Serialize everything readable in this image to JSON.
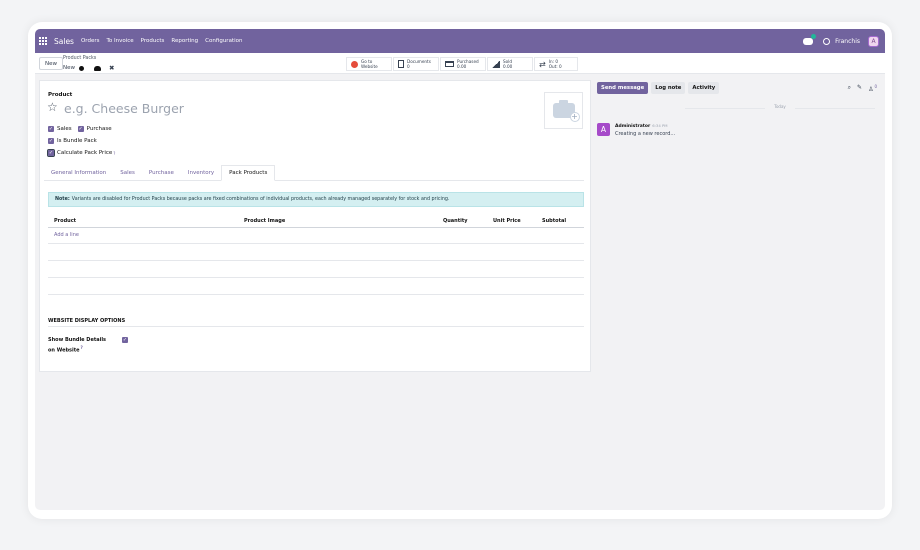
{
  "navbar": {
    "brand": "Sales",
    "menu": [
      "Orders",
      "To Invoice",
      "Products",
      "Reporting",
      "Configuration"
    ],
    "company": "Franchis",
    "avatar_letter": "A"
  },
  "control": {
    "new_label": "New",
    "breadcrumb_parent": "Product Packs",
    "breadcrumb_current": "New",
    "smart_buttons": [
      {
        "line1": "Go to",
        "line2": "Website",
        "icon": "globe-icon"
      },
      {
        "line1": "Documents",
        "line2": "0",
        "icon": "document-icon"
      },
      {
        "line1": "Purchased",
        "line2": "0.00",
        "icon": "credit-card-icon"
      },
      {
        "line1": "Sold",
        "line2": "0.00",
        "icon": "chart-icon"
      },
      {
        "line1": "In: 0",
        "line2": "Out: 0",
        "icon": "arrows-icon"
      }
    ]
  },
  "form": {
    "product_label": "Product",
    "name_placeholder": "e.g. Cheese Burger",
    "sales_label": "Sales",
    "purchase_label": "Purchase",
    "bundle_label": "Is Bundle Pack",
    "calc_label": "Calculate Pack Price",
    "help_mark": "?",
    "tabs": [
      "General Information",
      "Sales",
      "Purchase",
      "Inventory",
      "Pack Products"
    ],
    "note_bold": "Note:",
    "note_text": "Variants are disabled for Product Packs because packs are fixed combinations of individual products, each already managed separately for stock and pricing.",
    "columns": [
      "Product",
      "Product Image",
      "Quantity",
      "Unit Price",
      "Subtotal"
    ],
    "add_line": "Add a line",
    "section_title": "WEBSITE DISPLAY OPTIONS",
    "show_details_line1": "Show Bundle Details",
    "show_details_line2": "on Website"
  },
  "chatter": {
    "send_message": "Send message",
    "log_note": "Log note",
    "activity": "Activity",
    "follower_count": "0",
    "today": "Today",
    "message": {
      "avatar": "A",
      "author": "Administrator",
      "time": "6:34 PM",
      "body": "Creating a new record..."
    }
  },
  "colors": {
    "accent": "#71639e",
    "note_bg": "#d4eff1"
  }
}
